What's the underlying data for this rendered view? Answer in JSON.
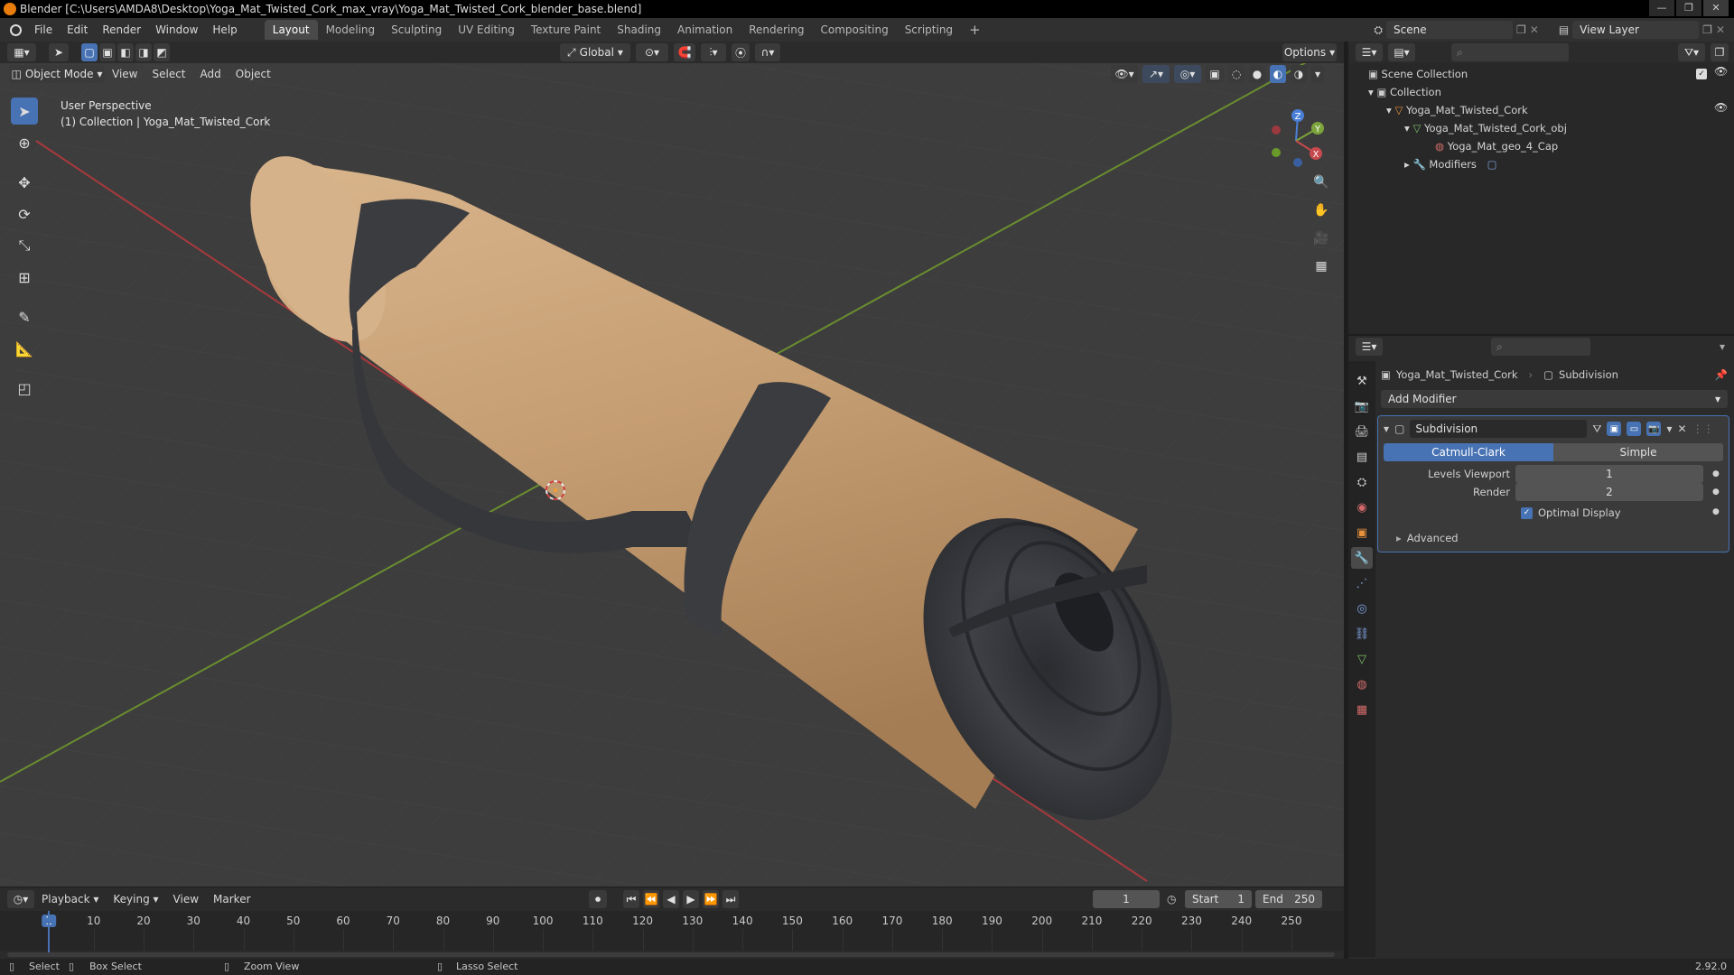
{
  "title": "Blender [C:\\Users\\AMDA8\\Desktop\\Yoga_Mat_Twisted_Cork_max_vray\\Yoga_Mat_Twisted_Cork_blender_base.blend]",
  "window_controls": [
    "—",
    "❐",
    "✕"
  ],
  "menu": [
    "File",
    "Edit",
    "Render",
    "Window",
    "Help"
  ],
  "workspaces": [
    "Layout",
    "Modeling",
    "Sculpting",
    "UV Editing",
    "Texture Paint",
    "Shading",
    "Animation",
    "Rendering",
    "Compositing",
    "Scripting"
  ],
  "active_workspace": "Layout",
  "add_workspace": "+",
  "scene": {
    "name": "Scene",
    "view_layer": "View Layer"
  },
  "viewport": {
    "transform_orientation": "Global",
    "options_label": "Options",
    "mode": "Object Mode",
    "header_menu": [
      "View",
      "Select",
      "Add",
      "Object"
    ],
    "overlay_line1": "User Perspective",
    "overlay_line2": "(1) Collection | Yoga_Mat_Twisted_Cork",
    "gizmo_axes": {
      "x": "X",
      "y": "Y",
      "z": "Z"
    }
  },
  "outliner": {
    "search_placeholder": "",
    "items": [
      {
        "label": "Scene Collection"
      },
      {
        "label": "Collection"
      },
      {
        "label": "Yoga_Mat_Twisted_Cork"
      },
      {
        "label": "Yoga_Mat_Twisted_Cork_obj"
      },
      {
        "label": "Yoga_Mat_geo_4_Cap"
      },
      {
        "label": "Modifiers"
      }
    ]
  },
  "properties": {
    "object_name": "Yoga_Mat_Twisted_Cork",
    "context": "Subdivision",
    "add_modifier": "Add Modifier",
    "modifier": {
      "name": "Subdivision",
      "type_options": [
        "Catmull-Clark",
        "Simple"
      ],
      "selected_type": "Catmull-Clark",
      "levels_viewport_label": "Levels Viewport",
      "levels_viewport": "1",
      "render_label": "Render",
      "render": "2",
      "optimal_display_label": "Optimal Display",
      "optimal_display": true,
      "advanced_label": "Advanced"
    }
  },
  "timeline": {
    "menu": [
      "Playback",
      "Keying",
      "View",
      "Marker"
    ],
    "current_frame": "1",
    "start_label": "Start",
    "start": "1",
    "end_label": "End",
    "end": "250",
    "ticks": [
      "1",
      "10",
      "20",
      "30",
      "40",
      "50",
      "60",
      "70",
      "80",
      "90",
      "100",
      "110",
      "120",
      "130",
      "140",
      "150",
      "160",
      "170",
      "180",
      "190",
      "200",
      "210",
      "220",
      "230",
      "240",
      "250"
    ]
  },
  "statusbar": {
    "items": [
      "Select",
      "Box Select",
      "Zoom View",
      "Lasso Select"
    ],
    "version": "2.92.0"
  },
  "colors": {
    "accent": "#4772b3",
    "x_axis": "#c6494d",
    "y_axis": "#7ca43a",
    "cork": "#c9a47c",
    "strap": "#3c3e42"
  }
}
